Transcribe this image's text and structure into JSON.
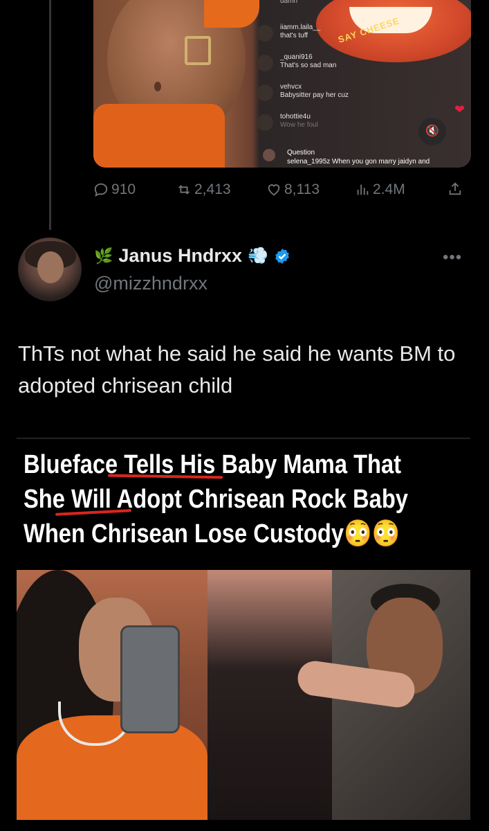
{
  "previous_tweet": {
    "media": {
      "say_cheese": "SAY CHEESE",
      "comments": [
        {
          "user": "",
          "text": "damn"
        },
        {
          "user": "iiamm.laila__",
          "text": "that's tuff"
        },
        {
          "user": "_quani916",
          "text": "That's so sad man"
        },
        {
          "user": "vehvcx",
          "text": "Babysitter pay her cuz"
        },
        {
          "user": "tohottie4u",
          "text": "Wow he foul"
        }
      ],
      "question_label": "Question",
      "question_text": "selena_1995z When you gon marry jaidyn and"
    },
    "stats": {
      "replies": "910",
      "reposts": "2,413",
      "likes": "8,113",
      "views": "2.4M"
    }
  },
  "tweet": {
    "display_name": "Janus Hndrxx",
    "handle": "@mizzhndrxx",
    "text": "ThTs not what he said he said he wants BM to adopted chrisean child",
    "embedded_image": {
      "headline_lines": [
        "Blueface Tells His Baby Mama That",
        "She Will Adopt Chrisean Rock Baby",
        "When Chrisean Lose Custody😳😳"
      ]
    }
  },
  "colors": {
    "background": "#000000",
    "text": "#e7e9ea",
    "muted": "#71767b",
    "verified": "#1d9bf0",
    "underline": "#d9261c"
  }
}
